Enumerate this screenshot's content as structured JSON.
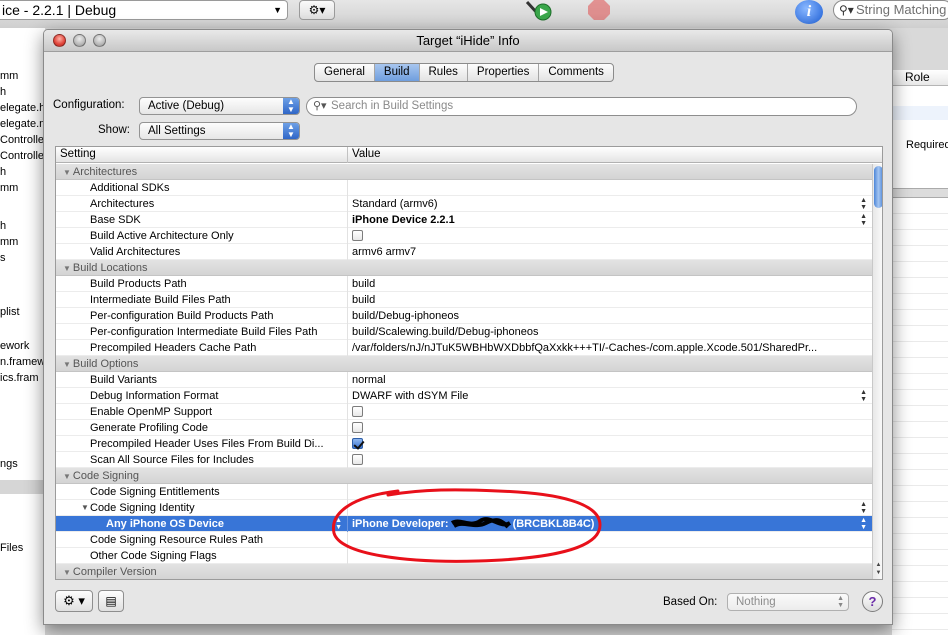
{
  "background": {
    "scheme_popup": "ice - 2.2.1 | Debug",
    "search_placeholder": "String Matching",
    "sidebar_items": [
      "mm",
      "h",
      "elegate.h",
      "elegate.m",
      "Controlle",
      "Controlle",
      "h",
      "mm",
      "h",
      "mm",
      "s",
      "plist",
      "ework",
      "n.framew",
      "ics.fram",
      "ngs",
      "Files"
    ],
    "right_header": "Role",
    "right_required": "Required"
  },
  "window": {
    "title": "Target “iHide” Info",
    "tabs": [
      "General",
      "Build",
      "Rules",
      "Properties",
      "Comments"
    ],
    "active_tab": "Build"
  },
  "filters": {
    "configuration_label": "Configuration:",
    "configuration_value": "Active (Debug)",
    "show_label": "Show:",
    "show_value": "All Settings",
    "search_placeholder": "Search in Build Settings"
  },
  "table": {
    "col_setting": "Setting",
    "col_value": "Value",
    "rows": [
      {
        "type": "group",
        "setting": "Architectures"
      },
      {
        "type": "row",
        "setting": "Additional SDKs",
        "value": ""
      },
      {
        "type": "row",
        "setting": "Architectures",
        "value": "Standard (armv6)",
        "stepper": true
      },
      {
        "type": "row",
        "setting": "Base SDK",
        "value": "iPhone Device 2.2.1",
        "bold": true,
        "stepper": true
      },
      {
        "type": "row",
        "setting": "Build Active Architecture Only",
        "checkbox": false
      },
      {
        "type": "row",
        "setting": "Valid Architectures",
        "value": "armv6 armv7"
      },
      {
        "type": "group",
        "setting": "Build Locations"
      },
      {
        "type": "row",
        "setting": "Build Products Path",
        "value": "build"
      },
      {
        "type": "row",
        "setting": "Intermediate Build Files Path",
        "value": "build"
      },
      {
        "type": "row",
        "setting": "Per-configuration Build Products Path",
        "value": "build/Debug-iphoneos"
      },
      {
        "type": "row",
        "setting": "Per-configuration Intermediate Build Files Path",
        "value": "build/Scalewing.build/Debug-iphoneos"
      },
      {
        "type": "row",
        "setting": "Precompiled Headers Cache Path",
        "value": "/var/folders/nJ/nJTuK5WBHbWXDbbfQaXxkk+++TI/-Caches-/com.apple.Xcode.501/SharedPr..."
      },
      {
        "type": "group",
        "setting": "Build Options"
      },
      {
        "type": "row",
        "setting": "Build Variants",
        "value": "normal"
      },
      {
        "type": "row",
        "setting": "Debug Information Format",
        "value": "DWARF with dSYM File",
        "stepper": true
      },
      {
        "type": "row",
        "setting": "Enable OpenMP Support",
        "checkbox": false
      },
      {
        "type": "row",
        "setting": "Generate Profiling Code",
        "checkbox": false
      },
      {
        "type": "row",
        "setting": "Precompiled Header Uses Files From Build Di...",
        "checkbox": true
      },
      {
        "type": "row",
        "setting": "Scan All Source Files for Includes",
        "checkbox": false
      },
      {
        "type": "group",
        "setting": "Code Signing"
      },
      {
        "type": "row",
        "setting": "Code Signing Entitlements",
        "value": ""
      },
      {
        "type": "row",
        "setting": "Code Signing Identity",
        "value": "",
        "disclosure": true,
        "stepper": true
      },
      {
        "type": "row",
        "setting": "Any iPhone OS Device",
        "value": "iPhone Developer:",
        "value_suffix": "(BRCBKL8B4C)",
        "selected": true,
        "bold": true,
        "indent": 2,
        "stepper": true,
        "redacted": true
      },
      {
        "type": "row",
        "setting": "Code Signing Resource Rules Path",
        "value": ""
      },
      {
        "type": "row",
        "setting": "Other Code Signing Flags",
        "value": ""
      },
      {
        "type": "group",
        "setting": "Compiler Version"
      }
    ]
  },
  "bottom": {
    "based_on_label": "Based On:",
    "based_on_value": "Nothing",
    "help_label": "?"
  },
  "colors": {
    "selection": "#3875d7",
    "annotation": "#e8101a"
  }
}
